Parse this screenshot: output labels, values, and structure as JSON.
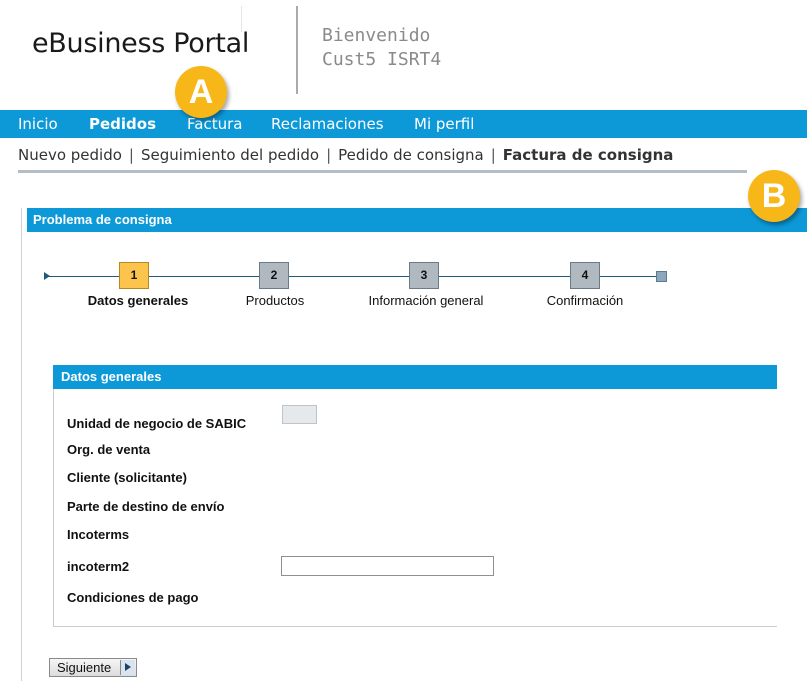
{
  "header": {
    "portal_title": "eBusiness Portal",
    "welcome_line1": "Bienvenido",
    "welcome_line2": "Cust5 ISRT4"
  },
  "callouts": {
    "a": "A",
    "b": "B"
  },
  "main_nav": {
    "items": [
      {
        "label": "Inicio",
        "active": false
      },
      {
        "label": "Pedidos",
        "active": true
      },
      {
        "label": "Factura",
        "active": false
      },
      {
        "label": "Reclamaciones",
        "active": false
      },
      {
        "label": "Mi perfil",
        "active": false
      }
    ]
  },
  "sub_nav": {
    "items": [
      {
        "label": "Nuevo pedido",
        "active": false
      },
      {
        "label": "Seguimiento del pedido",
        "active": false
      },
      {
        "label": "Pedido de consigna",
        "active": false
      },
      {
        "label": "Factura de consigna",
        "active": true
      }
    ],
    "separator": "|"
  },
  "panel": {
    "title": "Problema de consigna"
  },
  "steps": [
    {
      "number": "1",
      "label": "Datos generales",
      "active": true
    },
    {
      "number": "2",
      "label": "Productos",
      "active": false
    },
    {
      "number": "3",
      "label": "Información general",
      "active": false
    },
    {
      "number": "4",
      "label": "Confirmación",
      "active": false
    }
  ],
  "form": {
    "title": "Datos generales",
    "fields": {
      "business_unit": "Unidad de negocio de SABIC",
      "sales_org": "Org. de venta",
      "customer": "Cliente (solicitante)",
      "ship_to": "Parte de destino de envío",
      "incoterms": "Incoterms",
      "incoterm2": "incoterm2",
      "payment_terms": "Condiciones de pago"
    },
    "incoterm2_value": ""
  },
  "buttons": {
    "next_label": "Siguiente"
  },
  "colors": {
    "nav_blue": "#0d99d8",
    "badge_yellow": "#f7b718",
    "active_step": "#fcc44d",
    "inactive_step": "#b0b8c0"
  }
}
